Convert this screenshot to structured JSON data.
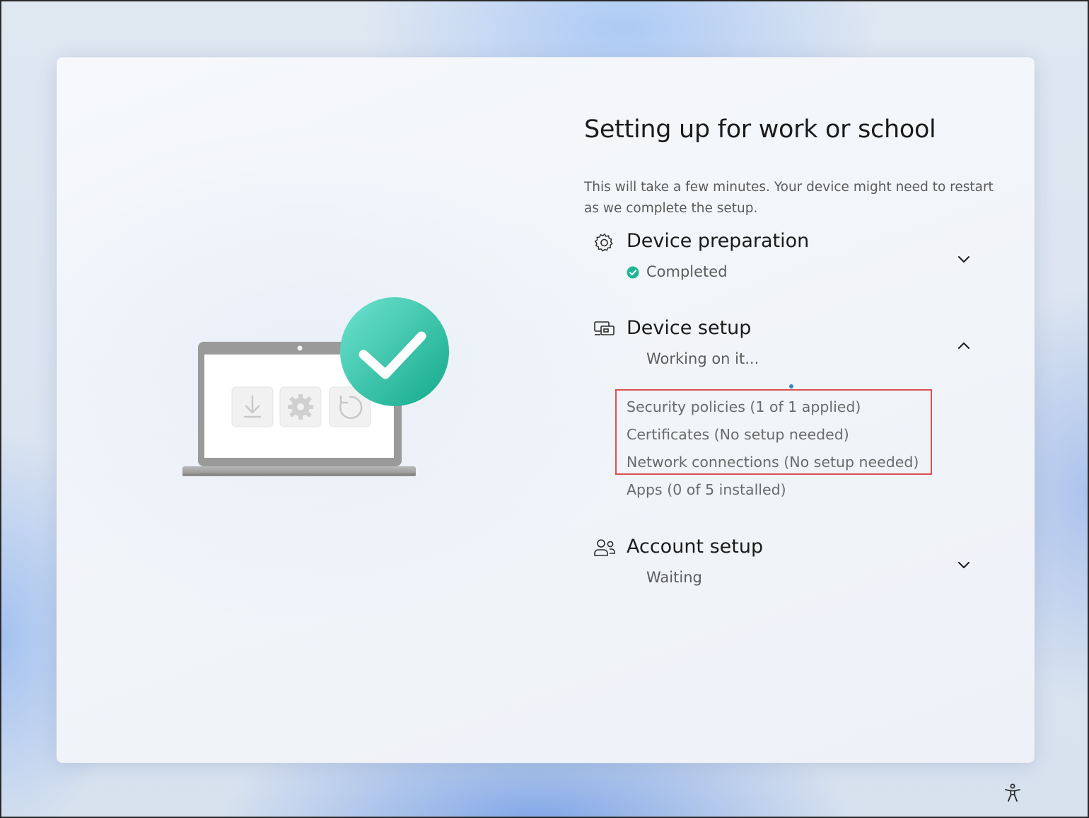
{
  "page": {
    "title": "Setting up for work or school",
    "subtitle": "This will take a few minutes. Your device might need to restart as we complete the setup."
  },
  "sections": [
    {
      "title": "Device preparation",
      "status": "Completed",
      "icon": "gear-icon",
      "expanded": false
    },
    {
      "title": "Device setup",
      "status": "Working on it...",
      "icon": "device-setup-icon",
      "expanded": true,
      "items": [
        "Security policies (1 of 1 applied)",
        "Certificates (No setup needed)",
        "Network connections (No setup needed)",
        "Apps (0 of 5 installed)"
      ]
    },
    {
      "title": "Account setup",
      "status": "Waiting",
      "icon": "account-users-icon",
      "expanded": false
    }
  ],
  "colors": {
    "accent_teal": "#3ccfb3",
    "check_green": "#1fb596",
    "highlight_red": "#d9534f",
    "progress_blue": "#3a86c8"
  },
  "icons": {
    "accessibility": "accessibility-icon",
    "download": "download-icon",
    "settings": "gear-icon",
    "restart": "restart-icon",
    "checkmark": "checkmark-icon"
  }
}
